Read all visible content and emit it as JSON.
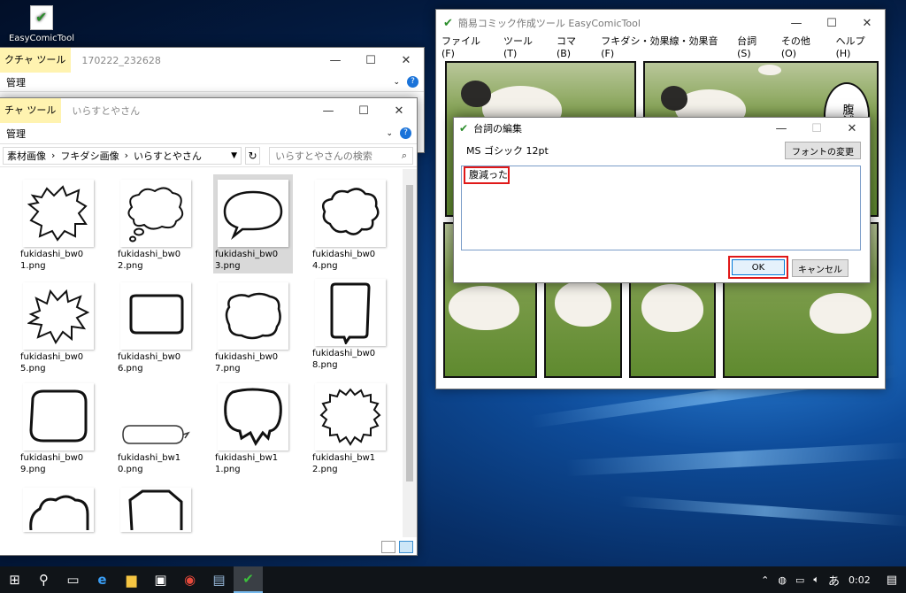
{
  "desktop": {
    "icon_label": "EasyComicTool"
  },
  "explorer_back": {
    "ribbon_tab": "クチャ ツール",
    "title": "170222_232628",
    "manage": "管理"
  },
  "explorer": {
    "ribbon_tab": "チャ ツール",
    "title": "いらすとやさん",
    "manage": "管理",
    "breadcrumb": [
      "素材画像",
      "フキダシ画像",
      "いらすとやさん"
    ],
    "search_placeholder": "いらすとやさんの検索",
    "files": [
      "fukidashi_bw01.png",
      "fukidashi_bw02.png",
      "fukidashi_bw03.png",
      "fukidashi_bw04.png",
      "fukidashi_bw05.png",
      "fukidashi_bw06.png",
      "fukidashi_bw07.png",
      "fukidashi_bw08.png",
      "fukidashi_bw09.png",
      "fukidashi_bw10.png",
      "fukidashi_bw11.png",
      "fukidashi_bw12.png"
    ]
  },
  "comic": {
    "title": "簡易コミック作成ツール EasyComicTool",
    "menu": [
      "ファイル(F)",
      "ツール(T)",
      "コマ(B)",
      "フキダシ・効果線・効果音(F)",
      "台詞(S)",
      "その他(O)"
    ],
    "help": "ヘルプ(H)",
    "balloon_text": "腹減"
  },
  "dialog": {
    "title": "台詞の編集",
    "font_label": "MS ゴシック 12pt",
    "font_button": "フォントの変更",
    "text_value": "腹減った",
    "ok": "OK",
    "cancel": "キャンセル"
  },
  "taskbar": {
    "ime": "あ",
    "time": "0:02"
  }
}
